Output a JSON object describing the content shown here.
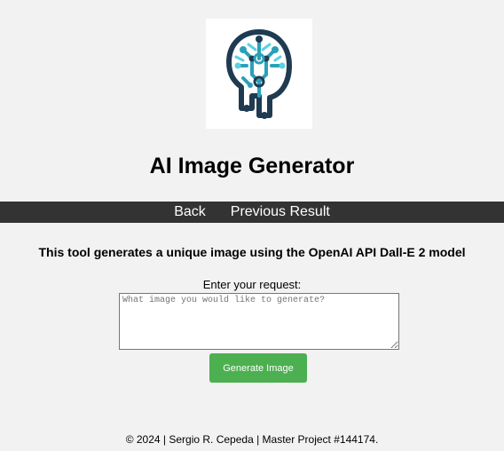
{
  "header": {
    "logo_icon": "brain-circuit-icon",
    "title": "AI Image Generator"
  },
  "nav": {
    "items": [
      {
        "label": "Back"
      },
      {
        "label": "Previous Result"
      }
    ]
  },
  "main": {
    "description": "This tool generates a unique image using the OpenAI API Dall-E 2 model",
    "request_label": "Enter your request:",
    "request_placeholder": "What image you would like to generate?",
    "request_value": "",
    "generate_label": "Generate Image"
  },
  "footer": {
    "text": "© 2024 | Sergio R. Cepeda | Master Project #144174."
  },
  "colors": {
    "background": "#f2f2f2",
    "navbar": "#333333",
    "button": "#4caf50",
    "logo_dark": "#1f3b52",
    "logo_teal": "#2aa1b8",
    "logo_light": "#5ad2e0"
  }
}
